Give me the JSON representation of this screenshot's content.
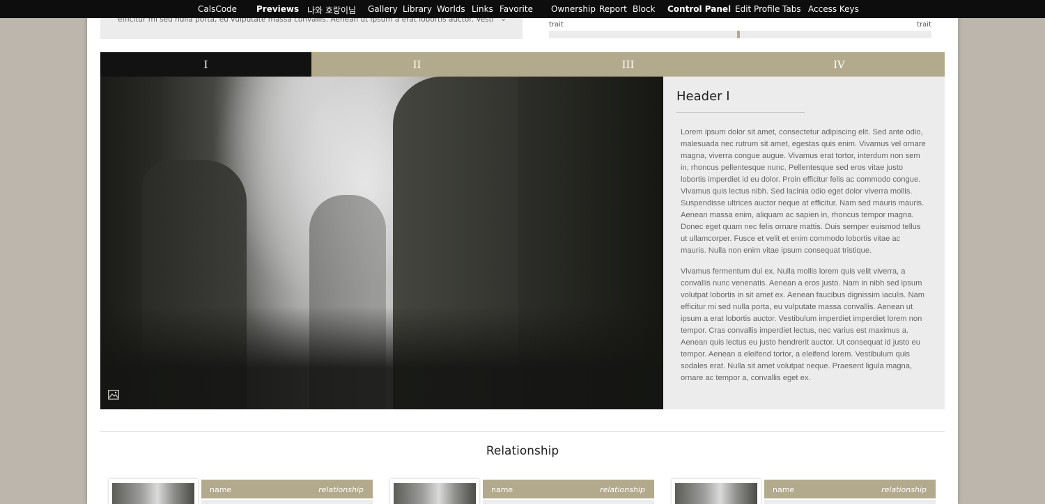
{
  "nav": {
    "left": [
      "CalsCode",
      "Previews",
      "나와 호랑이님",
      "Gallery",
      "Library",
      "Worlds",
      "Links",
      "Favorite"
    ],
    "right": [
      "Ownership",
      "Report",
      "Block",
      "Control Panel",
      "Edit Profile",
      "Tabs",
      "Access Keys"
    ]
  },
  "header": {
    "quote_text": "efficitur mi sed nulla porta, eu vulputate massa convallis. Aenean ut ipsum a erat lobortis auctor. Vestibulum",
    "chevron": "⌄",
    "trait": {
      "left_label": "trait",
      "right_label": "trait",
      "value": 0.496
    }
  },
  "tabs": [
    "I",
    "II",
    "III",
    "IV"
  ],
  "active_tab": 0,
  "panel": {
    "header": "Header I",
    "paragraph1": "Lorem ipsum dolor sit amet, consectetur adipiscing elit. Sed ante odio, malesuada nec rutrum sit amet, egestas quis enim. Vivamus vel ornare magna, viverra congue augue. Vivamus erat tortor, interdum non sem in, rhoncus pellentesque nunc. Pellentesque sed eros vitae justo lobortis imperdiet id eu dolor. Proin efficitur felis ac commodo congue. Vivamus quis lectus nibh. Sed lacinia odio eget dolor viverra mollis. Suspendisse ultrices auctor neque at efficitur. Nam sed mauris mauris. Aenean massa enim, aliquam ac sapien in, rhoncus tempor magna. Donec eget quam nec felis ornare mattis. Duis semper euismod tellus ut ullamcorper. Fusce et velit et enim commodo lobortis vitae ac mauris. Nulla non enim vitae ipsum consequat tristique.",
    "paragraph2": "Vivamus fermentum dui ex. Nulla mollis lorem quis velit viverra, a convallis nunc venenatis. Aenean a eros justo. Nam in nibh sed ipsum volutpat lobortis in sit amet ex. Aenean faucibus dignissim iaculis. Nam efficitur mi sed nulla porta, eu vulputate massa convallis. Aenean ut ipsum a erat lobortis auctor. Vestibulum imperdiet imperdiet lorem non tempor. Cras convallis imperdiet lectus, nec varius est maximus a. Aenean quis lectus eu justo hendrerit auctor. Ut consequat id justo eu tempor. Aenean a eleifend tortor, a eleifend lorem. Vestibulum quis sodales erat. Nulla sit amet volutpat neque. Praesent ligula magna, ornare ac tempor a, convallis eget ex."
  },
  "photo_icon": "image-icon",
  "relationship": {
    "title": "Relationship",
    "cards": [
      {
        "name": "name",
        "relation": "relationship"
      },
      {
        "name": "name",
        "relation": "relationship"
      },
      {
        "name": "name",
        "relation": "relationship"
      }
    ]
  },
  "colors": {
    "background": "#bcb6ad",
    "nav": "#0d0d0d",
    "accent": "#b3a98c",
    "active_tab": "#121212",
    "panel": "#ececec"
  }
}
